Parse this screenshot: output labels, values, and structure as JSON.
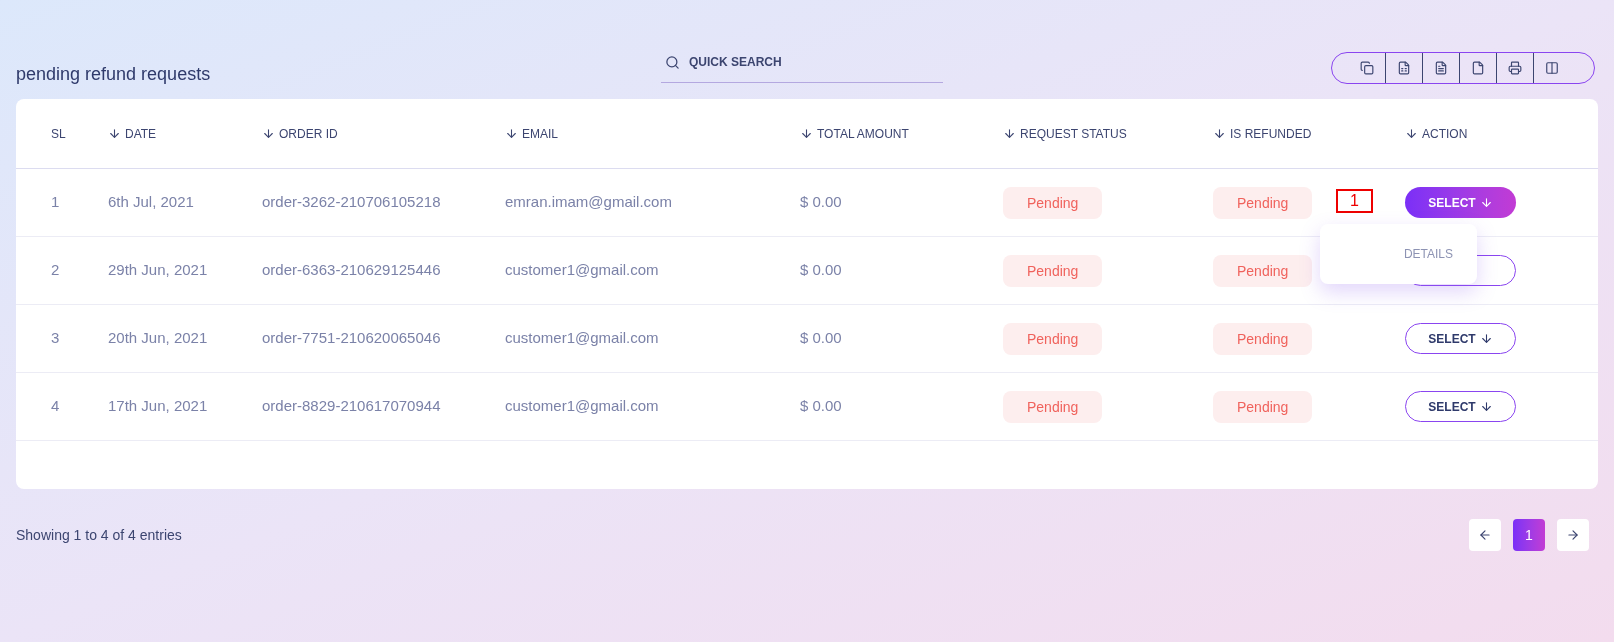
{
  "page_title": "pending refund requests",
  "search": {
    "placeholder": "QUICK SEARCH"
  },
  "export_tools": [
    {
      "kind": "copy"
    },
    {
      "kind": "excel"
    },
    {
      "kind": "csv"
    },
    {
      "kind": "pdf"
    },
    {
      "kind": "print"
    },
    {
      "kind": "columns"
    }
  ],
  "table": {
    "columns": [
      {
        "label": "SL",
        "sortable": false
      },
      {
        "label": "DATE",
        "sortable": true
      },
      {
        "label": "ORDER ID",
        "sortable": true
      },
      {
        "label": "EMAIL",
        "sortable": true
      },
      {
        "label": "TOTAL AMOUNT",
        "sortable": true
      },
      {
        "label": "REQUEST STATUS",
        "sortable": true
      },
      {
        "label": "IS REFUNDED",
        "sortable": true
      },
      {
        "label": "ACTION",
        "sortable": true
      }
    ],
    "rows": [
      {
        "sl": "1",
        "date": "6th Jul, 2021",
        "order_id": "order-3262-210706105218",
        "email": "emran.imam@gmail.com",
        "total": "$ 0.00",
        "request_status": "Pending",
        "is_refunded": "Pending",
        "action": {
          "label": "SELECT",
          "open": true,
          "menu": [
            "DETAILS"
          ]
        }
      },
      {
        "sl": "2",
        "date": "29th Jun, 2021",
        "order_id": "order-6363-210629125446",
        "email": "customer1@gmail.com",
        "total": "$ 0.00",
        "request_status": "Pending",
        "is_refunded": "Pending",
        "action": {
          "open": false
        }
      },
      {
        "sl": "3",
        "date": "20th Jun, 2021",
        "order_id": "order-7751-210620065046",
        "email": "customer1@gmail.com",
        "total": "$ 0.00",
        "request_status": "Pending",
        "is_refunded": "Pending",
        "action": {
          "label": "SELECT",
          "open": false
        }
      },
      {
        "sl": "4",
        "date": "17th Jun, 2021",
        "order_id": "order-8829-210617070944",
        "email": "customer1@gmail.com",
        "total": "$ 0.00",
        "request_status": "Pending",
        "is_refunded": "Pending",
        "action": {
          "label": "SELECT",
          "open": false
        }
      }
    ]
  },
  "annotation": "1",
  "footer": {
    "info": "Showing 1 to 4 of 4 entries",
    "pages": [
      {
        "label": "1",
        "selected": true
      }
    ]
  }
}
